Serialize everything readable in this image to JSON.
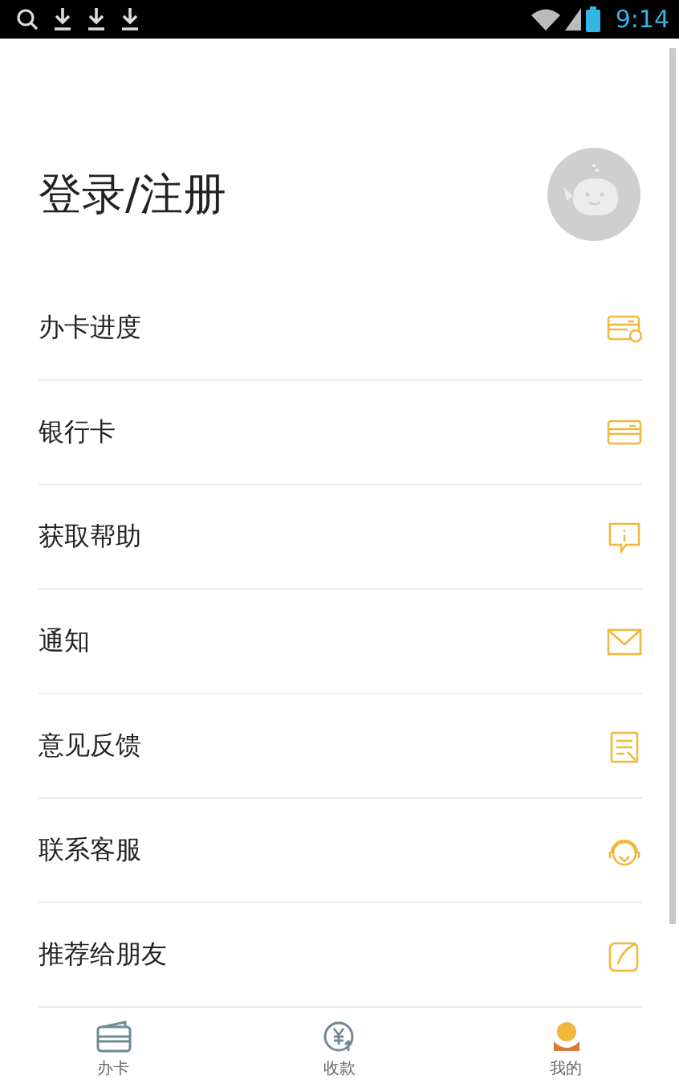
{
  "status_bar": {
    "time": "9:14"
  },
  "header": {
    "title": "登录/注册"
  },
  "menu": [
    {
      "label": "办卡进度",
      "kind": "progress"
    },
    {
      "label": "银行卡",
      "kind": "card"
    },
    {
      "label": "获取帮助",
      "kind": "help"
    },
    {
      "label": "通知",
      "kind": "mail"
    },
    {
      "label": "意见反馈",
      "kind": "feedback"
    },
    {
      "label": "联系客服",
      "kind": "service"
    },
    {
      "label": "推荐给朋友",
      "kind": "share"
    }
  ],
  "tabs": [
    {
      "label": "办卡",
      "kind": "card",
      "selected": false
    },
    {
      "label": "收款",
      "kind": "money",
      "selected": false
    },
    {
      "label": "我的",
      "kind": "me",
      "selected": true
    }
  ]
}
